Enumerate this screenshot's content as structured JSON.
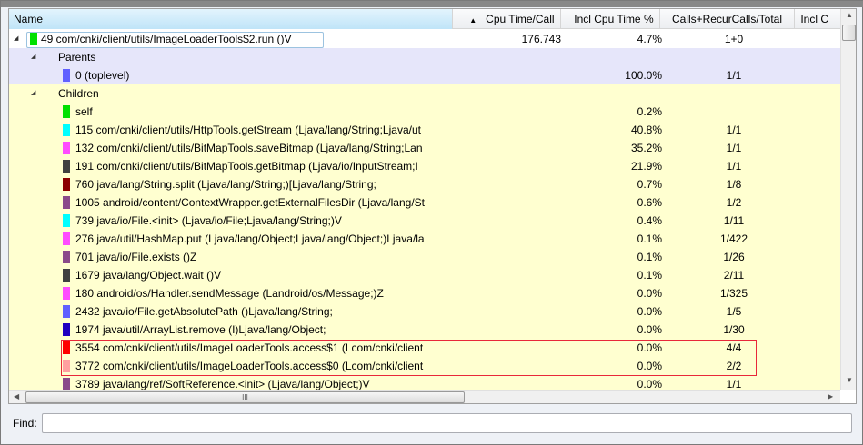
{
  "columns": {
    "name": "Name",
    "cpu_time_call": "Cpu Time/Call",
    "incl_cpu_pct": "Incl Cpu Time %",
    "calls": "Calls+RecurCalls/Total",
    "incl_more": "Incl C"
  },
  "sort_indicator": "▲",
  "selected": {
    "name": "49 com/cnki/client/utils/ImageLoaderTools$2.run ()V",
    "cpu_time_call": "176.743",
    "incl_pct": "4.7%",
    "calls": "1+0",
    "color": "#00e000"
  },
  "parents_label": "Parents",
  "parents": [
    {
      "name": "0 (toplevel)",
      "pct": "100.0%",
      "calls": "1/1",
      "color": "#6060ff"
    }
  ],
  "children_label": "Children",
  "children": [
    {
      "name": "self",
      "pct": "0.2%",
      "calls": "",
      "color": "#00e000"
    },
    {
      "name": "115 com/cnki/client/utils/HttpTools.getStream (Ljava/lang/String;Ljava/ut",
      "pct": "40.8%",
      "calls": "1/1",
      "color": "#00ffff"
    },
    {
      "name": "132 com/cnki/client/utils/BitMapTools.saveBitmap (Ljava/lang/String;Lan",
      "pct": "35.2%",
      "calls": "1/1",
      "color": "#ff4cff"
    },
    {
      "name": "191 com/cnki/client/utils/BitMapTools.getBitmap (Ljava/io/InputStream;I",
      "pct": "21.9%",
      "calls": "1/1",
      "color": "#404040"
    },
    {
      "name": "760 java/lang/String.split (Ljava/lang/String;)[Ljava/lang/String;",
      "pct": "0.7%",
      "calls": "1/8",
      "color": "#8b0000"
    },
    {
      "name": "1005 android/content/ContextWrapper.getExternalFilesDir (Ljava/lang/St",
      "pct": "0.6%",
      "calls": "1/2",
      "color": "#8a4a8a"
    },
    {
      "name": "739 java/io/File.<init> (Ljava/io/File;Ljava/lang/String;)V",
      "pct": "0.4%",
      "calls": "1/11",
      "color": "#00ffff"
    },
    {
      "name": "276 java/util/HashMap.put (Ljava/lang/Object;Ljava/lang/Object;)Ljava/la",
      "pct": "0.1%",
      "calls": "1/422",
      "color": "#ff4cff"
    },
    {
      "name": "701 java/io/File.exists ()Z",
      "pct": "0.1%",
      "calls": "1/26",
      "color": "#8a4a8a"
    },
    {
      "name": "1679 java/lang/Object.wait ()V",
      "pct": "0.1%",
      "calls": "2/11",
      "color": "#404040"
    },
    {
      "name": "180 android/os/Handler.sendMessage (Landroid/os/Message;)Z",
      "pct": "0.0%",
      "calls": "1/325",
      "color": "#ff4cff"
    },
    {
      "name": "2432 java/io/File.getAbsolutePath ()Ljava/lang/String;",
      "pct": "0.0%",
      "calls": "1/5",
      "color": "#6060ff"
    },
    {
      "name": "1974 java/util/ArrayList.remove (I)Ljava/lang/Object;",
      "pct": "0.0%",
      "calls": "1/30",
      "color": "#2000c0"
    },
    {
      "name": "3554 com/cnki/client/utils/ImageLoaderTools.access$1 (Lcom/cnki/client",
      "pct": "0.0%",
      "calls": "4/4",
      "color": "#ff0000"
    },
    {
      "name": "3772 com/cnki/client/utils/ImageLoaderTools.access$0 (Lcom/cnki/client",
      "pct": "0.0%",
      "calls": "2/2",
      "color": "#ffa0a0"
    },
    {
      "name": "3789 java/lang/ref/SoftReference.<init> (Ljava/lang/Object;)V",
      "pct": "0.0%",
      "calls": "1/1",
      "color": "#8a4a8a"
    }
  ],
  "hscroll_grip": "III",
  "find_label": "Find:",
  "find_value": ""
}
